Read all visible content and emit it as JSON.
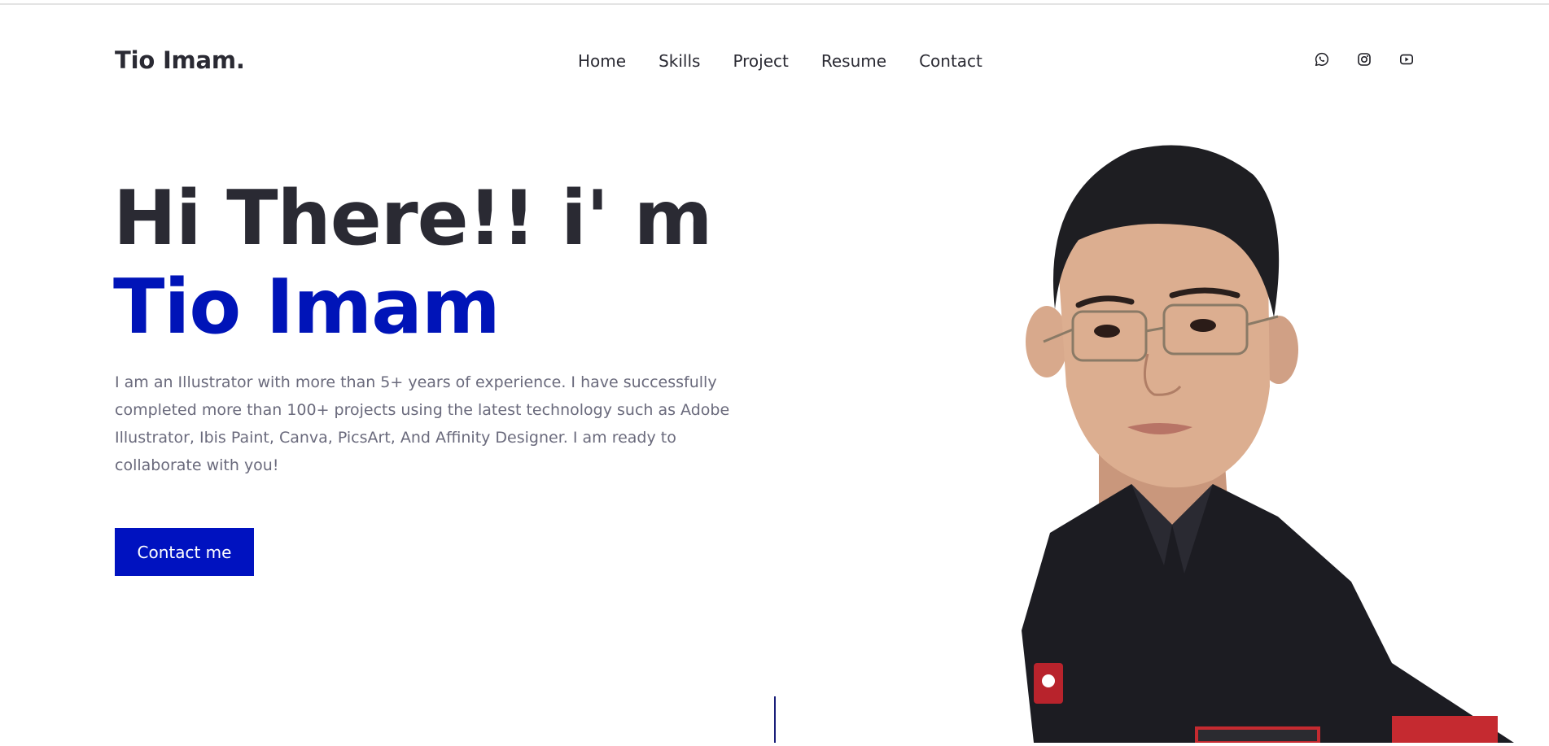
{
  "brand": {
    "logo_text": "Tio Imam."
  },
  "nav": {
    "items": [
      "Home",
      "Skills",
      "Project",
      "Resume",
      "Contact"
    ]
  },
  "socials": [
    "whatsapp-icon",
    "instagram-icon",
    "youtube-icon"
  ],
  "hero": {
    "greeting": "Hi There!! i' m",
    "name": "Tio Imam",
    "intro": "I am an Illustrator with more than 5+ years of experience. I have successfully completed more than 100+ projects using the latest technology such as Adobe Illustrator, Ibis Paint, Canva, PicsArt, And Affinity Designer. I am ready to collaborate with you!",
    "cta_label": "Contact me"
  },
  "colors": {
    "accent": "#0012c0",
    "heading": "#2a2a33",
    "body_text": "#6a6a7c",
    "shirt": "#1c1c22"
  }
}
